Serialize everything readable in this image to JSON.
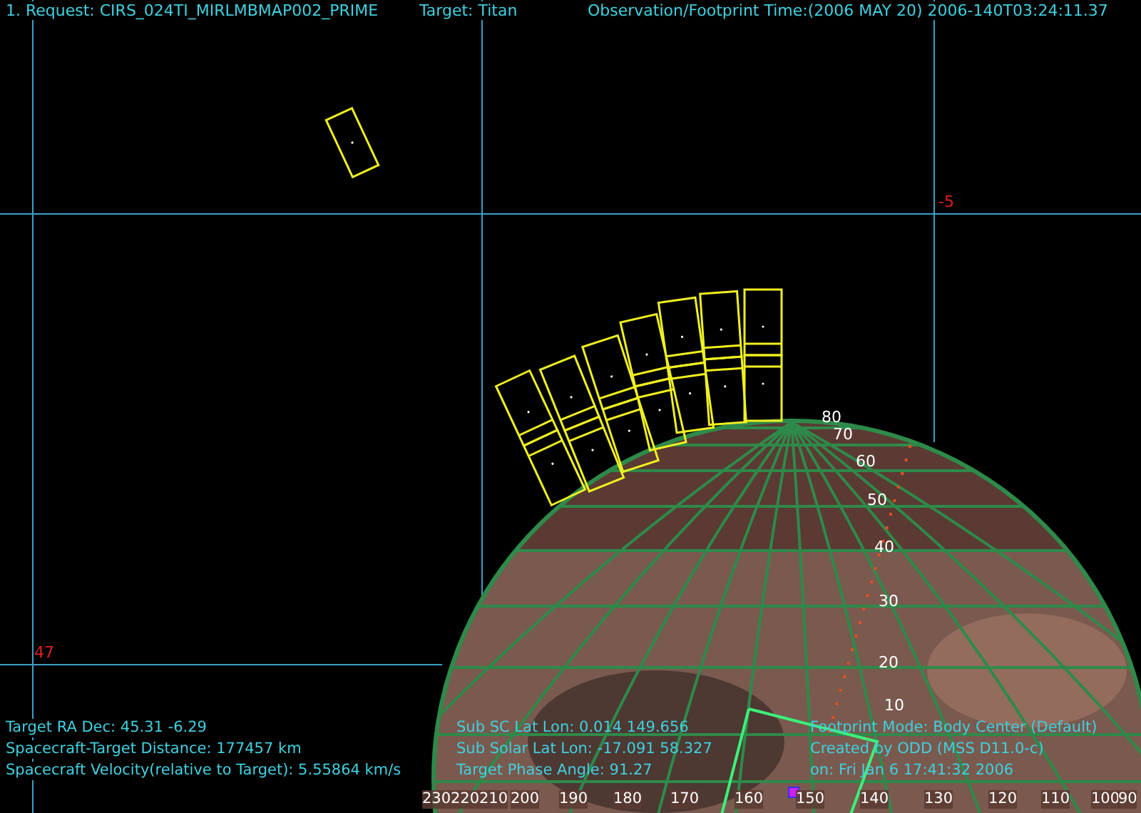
{
  "header": {
    "request": "1. Request:  CIRS_024TI_MIRLMBMAP002_PRIME",
    "target": "Target: Titan",
    "time": "Observation/Footprint Time:(2006 MAY 20) 2006-140T03:24:11.37"
  },
  "grid_labels": [
    "-5",
    "47"
  ],
  "latitude_labels": [
    "80",
    "70",
    "60",
    "50",
    "40",
    "30",
    "20",
    "10"
  ],
  "longitude_labels": [
    "230",
    "220",
    "210",
    "200",
    "190",
    "180",
    "170",
    "160",
    "150",
    "140",
    "130",
    "120",
    "110",
    "100",
    "90"
  ],
  "info_left": [
    "Target RA  Dec: 45.31   -6.29",
    "Spacecraft-Target Distance:  177457 km",
    "Spacecraft Velocity(relative to Target): 5.55864 km/s"
  ],
  "info_middle": [
    "Sub SC Lat Lon:  0.014  149.656",
    "Sub Solar Lat Lon:  -17.091  58.327",
    "Target Phase Angle:  91.27"
  ],
  "info_right": [
    "Footprint Mode: Body Center (Default)",
    "Created by ODD (MSS D11.0-c)",
    "on: Fri Jan  6 17:41:32 2006"
  ]
}
